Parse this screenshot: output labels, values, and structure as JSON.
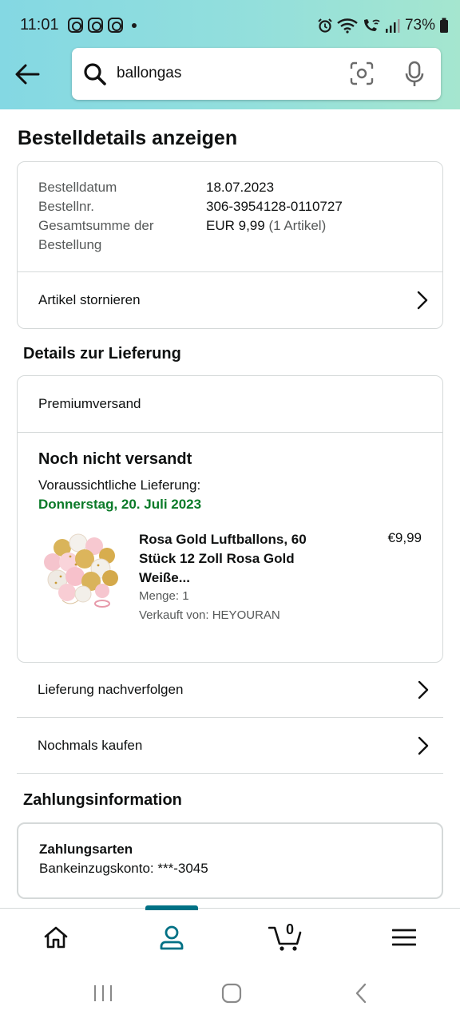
{
  "status_bar": {
    "time": "11:01",
    "battery": "73%",
    "icons": [
      "instagram-icon",
      "instagram-icon",
      "instagram-icon",
      "alarm-icon",
      "wifi-icon",
      "wifi-call-icon",
      "signal-icon",
      "battery-icon"
    ]
  },
  "search": {
    "value": "ballongas",
    "icons": [
      "back-arrow-icon",
      "search-icon",
      "camera-scan-icon",
      "microphone-icon"
    ]
  },
  "page": {
    "title": "Bestelldetails anzeigen"
  },
  "order_summary": {
    "rows": [
      {
        "label": "Bestelldatum",
        "value": "18.07.2023",
        "extra": ""
      },
      {
        "label": "Bestellnr.",
        "value": "306-3954128-0110727",
        "extra": ""
      },
      {
        "label": "Gesamtsumme der Bestellung",
        "value": "EUR 9,99",
        "extra": "(1 Artikel)"
      }
    ],
    "cancel_label": "Artikel stornieren"
  },
  "delivery": {
    "heading": "Details zur Lieferung",
    "shipping_type": "Premiumversand",
    "status": "Noch nicht versandt",
    "expected_label": "Voraussichtliche Lieferung:",
    "expected_date": "Donnerstag, 20. Juli 2023",
    "product": {
      "title": "Rosa Gold Luftballons, 60 Stück 12 Zoll Rosa Gold Weiße...",
      "price": "€9,99",
      "quantity": "Menge: 1",
      "seller": "Verkauft von: HEYOURAN"
    },
    "track_label": "Lieferung nachverfolgen",
    "buy_again_label": "Nochmals kaufen"
  },
  "payment": {
    "heading": "Zahlungsinformation",
    "method_title": "Zahlungsarten",
    "method_value": "Bankeinzugskonto: ***-3045"
  },
  "bottom_nav": {
    "cart_count": "0",
    "active": "account",
    "accent": "#007185"
  },
  "colors": {
    "header_gradient_start": "#84d8e3",
    "header_gradient_end": "#a5e6cf",
    "delivery_date_green": "#0a7a28"
  }
}
